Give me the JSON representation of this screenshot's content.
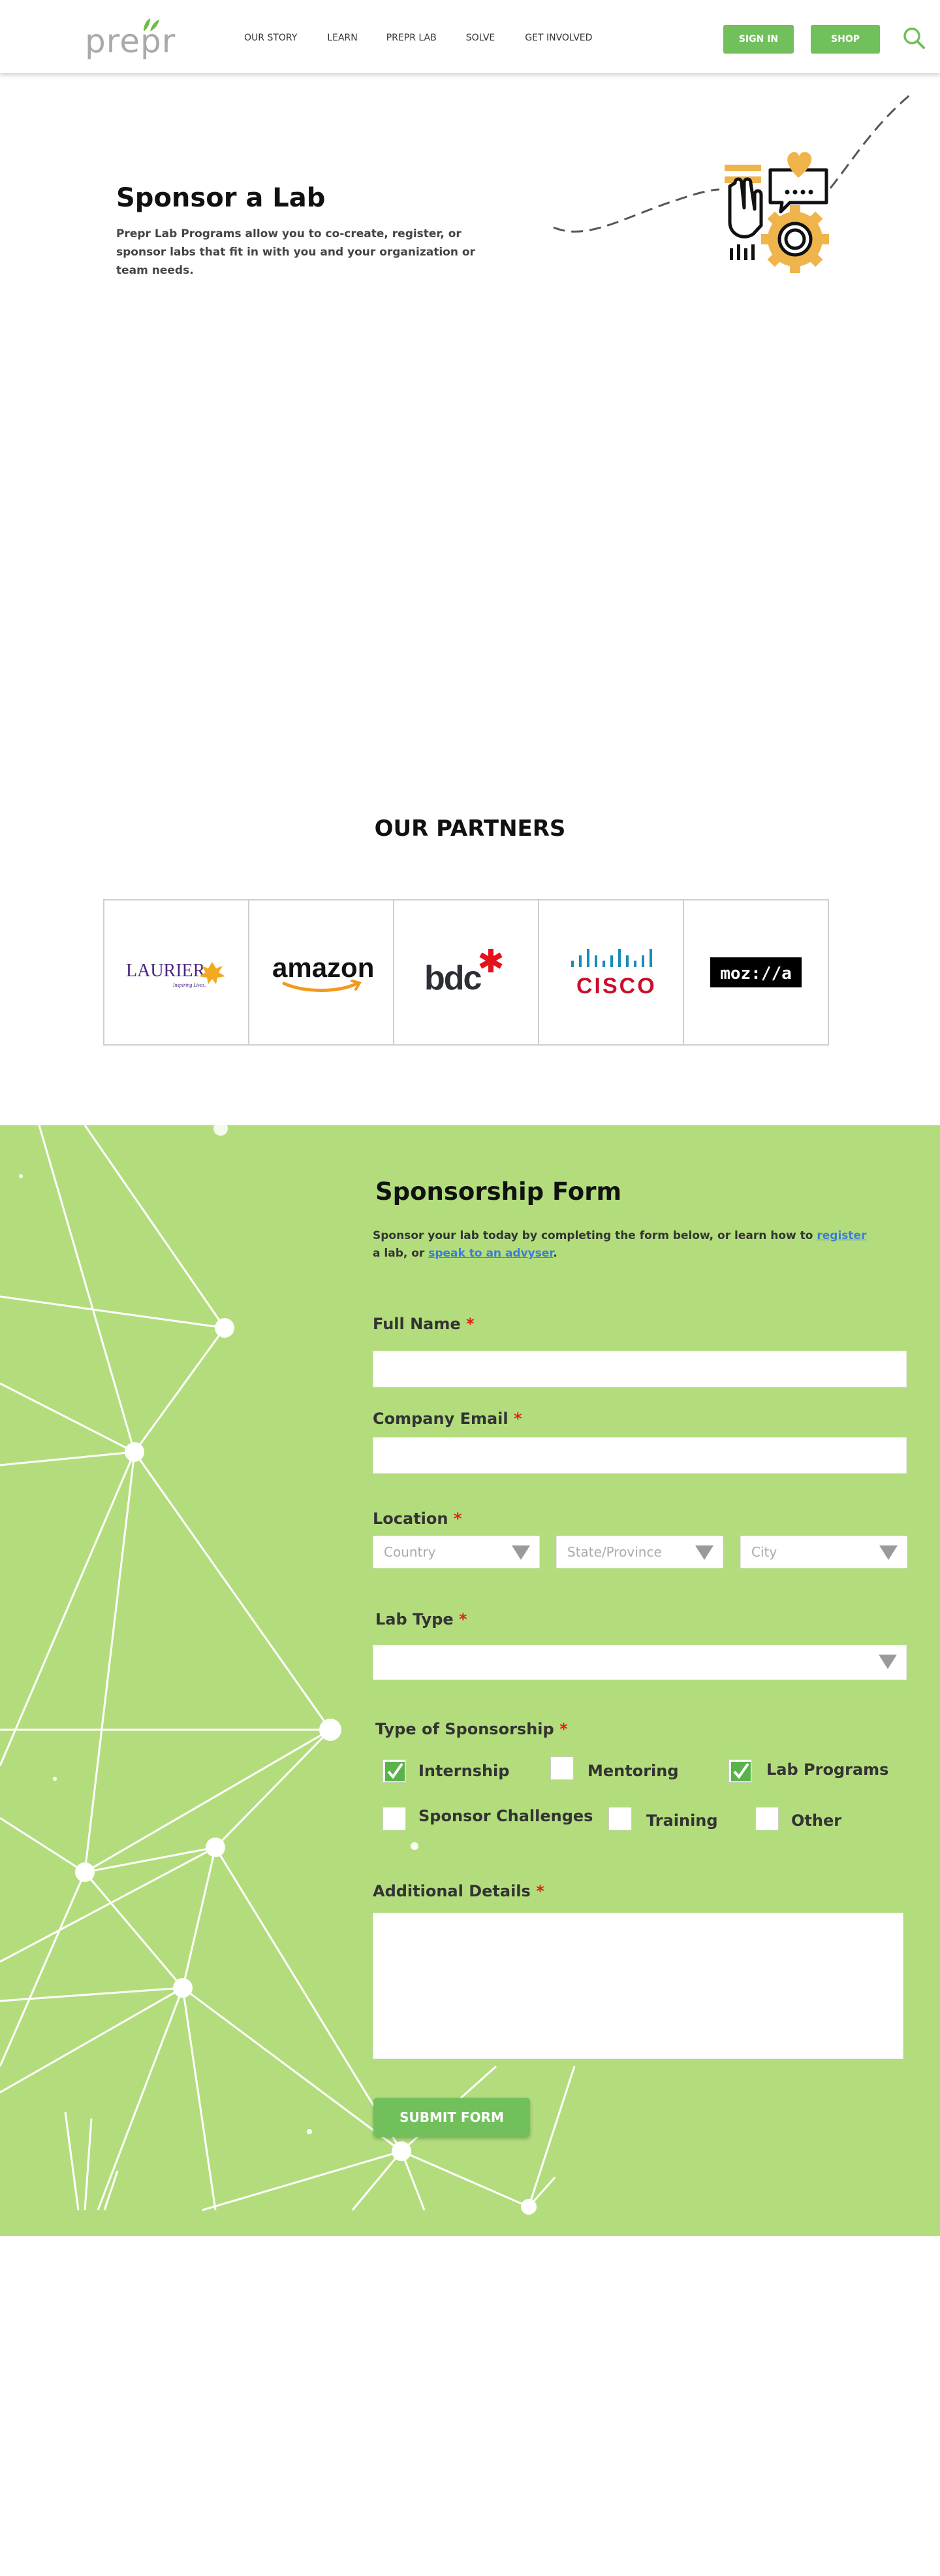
{
  "header": {
    "logo_text": "prepr",
    "nav": [
      "OUR STORY",
      "LEARN",
      "PREPR LAB",
      "SOLVE",
      "GET INVOLVED"
    ],
    "signin_label": "SIGN IN",
    "shop_label": "SHOP"
  },
  "hero": {
    "title": "Sponsor a Lab",
    "text": "Prepr Lab Programs allow you to co-create, register, or sponsor labs that fit in with you and your organization or team needs."
  },
  "partners": {
    "title": "OUR PARTNERS",
    "logos": [
      {
        "name": "LAURIER",
        "tagline": "Inspiring Lives."
      },
      {
        "name": "amazon"
      },
      {
        "name": "bdc"
      },
      {
        "name": "CISCO"
      },
      {
        "name": "moz://a"
      }
    ]
  },
  "form": {
    "title": "Sponsorship Form",
    "intro_pre": "Sponsor your lab today by completing the form below, or learn how to ",
    "intro_link1": "register",
    "intro_mid": " a lab, or ",
    "intro_link2": "speak to an advyser",
    "intro_end": ".",
    "full_name_label": "Full Name",
    "email_label": "Company Email",
    "location_label": "Location",
    "country_placeholder": "Country",
    "state_placeholder": "State/Province",
    "city_placeholder": "City",
    "lab_type_label": "Lab Type",
    "sponsorship_label": "Type of Sponsorship",
    "options": [
      {
        "label": "Internship",
        "checked": true
      },
      {
        "label": "Mentoring",
        "checked": false
      },
      {
        "label": "Lab Programs",
        "checked": true
      },
      {
        "label": "Sponsor Challenges",
        "checked": false
      },
      {
        "label": "Training",
        "checked": false
      },
      {
        "label": "Other",
        "checked": false
      }
    ],
    "details_label": "Additional Details",
    "required_mark": "*",
    "submit_label": "SUBMIT FORM"
  },
  "colors": {
    "accent": "#72c05c",
    "form_bg": "#b3dd7d",
    "link": "#3b7dd8",
    "required": "#e0221b",
    "illus_orange": "#f0b44c"
  }
}
